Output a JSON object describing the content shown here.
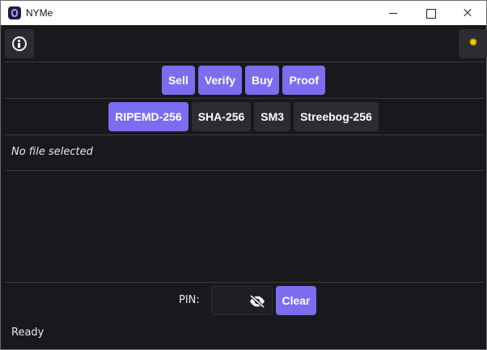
{
  "window": {
    "title": "NYMe"
  },
  "toolbar": {
    "info_icon": "info-icon",
    "theme_icon": "sun-icon"
  },
  "actions": [
    {
      "label": "Sell"
    },
    {
      "label": "Verify"
    },
    {
      "label": "Buy"
    },
    {
      "label": "Proof"
    }
  ],
  "hashes": [
    {
      "label": "RIPEMD-256",
      "selected": true
    },
    {
      "label": "SHA-256",
      "selected": false
    },
    {
      "label": "SM3",
      "selected": false
    },
    {
      "label": "Streebog-256",
      "selected": false
    }
  ],
  "file": {
    "status": "No file selected"
  },
  "pin": {
    "label": "PIN:",
    "value": "",
    "visibility_icon": "eye-off-icon",
    "clear_label": "Clear"
  },
  "status": {
    "text": "Ready"
  },
  "colors": {
    "accent": "#7b6cf0",
    "background": "#19191d",
    "surface": "#2c2c31",
    "sun": "#ffc400"
  }
}
